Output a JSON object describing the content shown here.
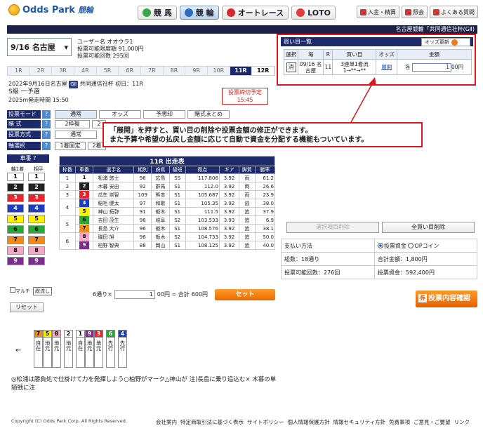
{
  "brand": {
    "name": "Odds Park",
    "sub": "競輪"
  },
  "topnav": [
    {
      "label": "競 馬",
      "color": "#3aa64a",
      "on": false
    },
    {
      "label": "競 輪",
      "color": "#2b6cc0",
      "on": true
    },
    {
      "label": "オートレース",
      "color": "#d8282e",
      "on": false
    },
    {
      "label": "LOTO",
      "color": "#e23c3c",
      "on": false
    }
  ],
  "util": [
    "入金・精算",
    "照会",
    "よくある質問"
  ],
  "header": {
    "venue_breadcrumb": "名古屋競輪「共同通信社杯(GⅡ)"
  },
  "venue": {
    "value": "9/16 名古屋"
  },
  "user": {
    "name": "ユーザー名 オオウラ1",
    "limit": "投票可能限度額 91,000円",
    "count": "投票可能回数 295回"
  },
  "races": [
    "1R",
    "2R",
    "3R",
    "4R",
    "5R",
    "6R",
    "7R",
    "8R",
    "9R",
    "10R",
    "11R",
    "12R"
  ],
  "race": {
    "date_line": "2022年9月16日名古屋",
    "grade": "GⅡ",
    "event": "共同通信社杯 初日：11R",
    "class": "S級 一予選",
    "distance": "2025m発走時間 15:50",
    "deadline_label": "投票締切予定",
    "deadline_time": "15:45"
  },
  "modes": {
    "mode_label": "投票モード",
    "mode_buttons": [
      "通常",
      "オッズ",
      "予想印",
      "賭式まとめ"
    ],
    "type_label": "賭 式",
    "type_buttons": [
      "2枠複",
      "2"
    ],
    "method_label": "投票方式",
    "method_buttons": [
      "通常"
    ],
    "axis_label": "軸選択",
    "axis_buttons": [
      "1着固定",
      "2着"
    ]
  },
  "car_panel": {
    "title": "車番",
    "col1": "軸1着",
    "col2": "相手",
    "multi": "マルチ",
    "nagashi": "総流し",
    "reset": "リセット"
  },
  "car_colors": {
    "1": "#ffffff",
    "2": "#222222",
    "3": "#e8252a",
    "4": "#1d3fbf",
    "5": "#fff200",
    "6": "#29a838",
    "7": "#f08a1c",
    "8": "#f4a6c8",
    "9": "#7b2d8e"
  },
  "entries": {
    "title": "11R 出走表",
    "headers": [
      "枠番",
      "車番",
      "選手名",
      "期別",
      "府県",
      "級班",
      "得点",
      "ギア",
      "脚質",
      "勝率"
    ],
    "rows": [
      {
        "waku": "1",
        "car": "1",
        "name": "松浦 悠士",
        "term": "98",
        "pref": "広島",
        "class": "SS",
        "score": "117.806",
        "gear": "3.92",
        "style": "両",
        "rate": "61.2"
      },
      {
        "waku": "2",
        "car": "2",
        "name": "木暮 安由",
        "term": "92",
        "pref": "群馬",
        "class": "S1",
        "score": "112.0",
        "gear": "3.92",
        "style": "両",
        "rate": "26.6"
      },
      {
        "waku": "3",
        "car": "3",
        "name": "瓜生 崇智",
        "term": "109",
        "pref": "熊本",
        "class": "S1",
        "score": "105.687",
        "gear": "3.92",
        "style": "両",
        "rate": "23.9"
      },
      {
        "waku": "4",
        "car": "4",
        "name": "稲毛 健太",
        "term": "97",
        "pref": "和歌",
        "class": "S1",
        "score": "105.35",
        "gear": "3.92",
        "style": "逃",
        "rate": "38.0"
      },
      {
        "waku": "",
        "car": "5",
        "name": "神山 拓弥",
        "term": "91",
        "pref": "栃木",
        "class": "S1",
        "score": "111.5",
        "gear": "3.92",
        "style": "追",
        "rate": "37.9"
      },
      {
        "waku": "5",
        "car": "6",
        "name": "吉田 茂生",
        "term": "98",
        "pref": "岐阜",
        "class": "S2",
        "score": "103.533",
        "gear": "3.93",
        "style": "追",
        "rate": "6.9"
      },
      {
        "waku": "",
        "car": "7",
        "name": "長島 大介",
        "term": "96",
        "pref": "栃木",
        "class": "S1",
        "score": "108.576",
        "gear": "3.92",
        "style": "追",
        "rate": "38.1"
      },
      {
        "waku": "6",
        "car": "8",
        "name": "磯田 旭",
        "term": "96",
        "pref": "栃木",
        "class": "S2",
        "score": "104.733",
        "gear": "3.92",
        "style": "追",
        "rate": "50.0"
      },
      {
        "waku": "",
        "car": "9",
        "name": "柏野 智典",
        "term": "88",
        "pref": "岡山",
        "class": "S1",
        "score": "108.125",
        "gear": "3.92",
        "style": "追",
        "rate": "40.0"
      }
    ]
  },
  "betbar": {
    "count": "6通り×",
    "unit": "1",
    "unit_suffix": "00円 = 合計",
    "total": "600円",
    "set": "セット"
  },
  "cart": {
    "title": "買い目一覧",
    "odds_update": "オッズ更新",
    "headers": [
      "選択",
      "場",
      "R",
      "買い目",
      "オッズ",
      "金額"
    ],
    "row": {
      "select": "消",
      "venue": "09/16 名古屋",
      "race": "11",
      "pick": "3連単1着流 1→**→**",
      "odds": "展開",
      "amount_prefix": "各",
      "amount": "1",
      "amount_suffix": "00円"
    }
  },
  "callout": {
    "line1": "「展開」を押すと、買い目の削除や投票金額の修正ができます。",
    "line2": "また予算や希望の払戻し金額に応じて自動で資金を分配する機能もついています。"
  },
  "actions": {
    "delete_selected": "選択項目削除",
    "delete_all": "全買い目削除"
  },
  "payment": {
    "method_label": "支払い方法",
    "opt1": "投票資金",
    "opt2": "OPコイン",
    "combos": "組数：18通り",
    "total": "合計金額：1,800円",
    "remaining": "投票可能回数：276回",
    "funds": "投票資金：592,400円"
  },
  "confirm": "投票内容確認",
  "formation": {
    "groups": [
      [
        {
          "n": "7",
          "c": "#f08a1c",
          "tag": "自在"
        },
        {
          "n": "5",
          "c": "#fff200",
          "tag": "地元"
        },
        {
          "n": "8",
          "c": "#f4a6c8",
          "tag": "地元"
        }
      ],
      [
        {
          "n": "2",
          "c": "#ffffff",
          "tag": "地元"
        }
      ],
      [
        {
          "n": "1",
          "c": "#ffffff",
          "tag": "自在"
        },
        {
          "n": "9",
          "c": "#7b2d8e",
          "tag": "地元"
        },
        {
          "n": "3",
          "c": "#e8252a",
          "tag": "地元"
        }
      ],
      [
        {
          "n": "6",
          "c": "#29a838",
          "tag": "先行"
        }
      ],
      [
        {
          "n": "4",
          "c": "#1d3fbf",
          "tag": "先行"
        }
      ]
    ],
    "arrow": "←"
  },
  "comment": "◎松浦は勝負処で仕掛けて力を発揮しよう○柏野がマーク△神山が 注)長島に乗り追込む× 木暮の単騎戦に注",
  "footer": {
    "copyright": "Copyright (C) Odds Park Corp. All Rights Reserved.",
    "links": [
      "会社案内",
      "特定商取引法に基づく表示",
      "サイトポリシー",
      "個人情報保護方針",
      "情報セキュリティ方針",
      "免責事項",
      "ご意見・ご要望",
      "リンク"
    ]
  }
}
